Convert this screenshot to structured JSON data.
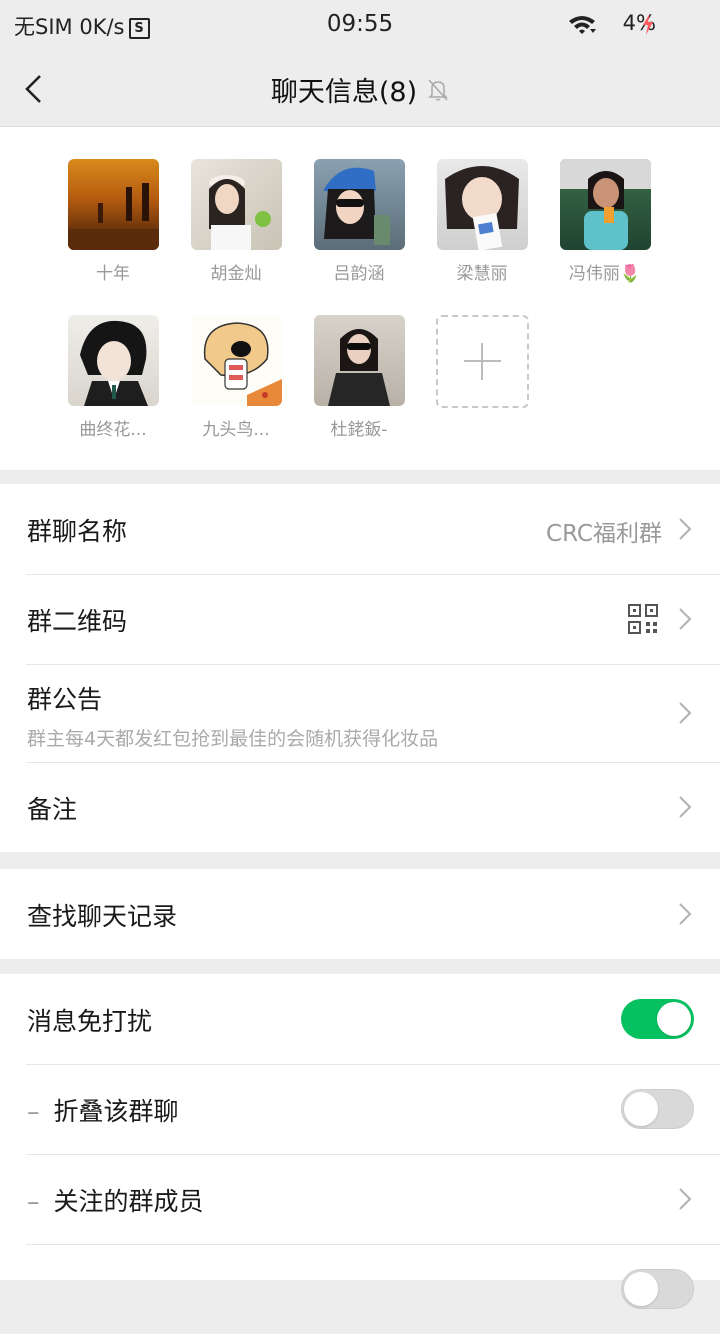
{
  "status_bar": {
    "carrier": "无SIM",
    "speed": "0K/s",
    "s_badge": "S",
    "time": "09:55",
    "battery": "4%"
  },
  "nav": {
    "title": "聊天信息(8)",
    "back_icon": "chevron-left-icon",
    "mute_icon": "bell-off-icon"
  },
  "members": [
    {
      "name": "十年"
    },
    {
      "name": "胡金灿"
    },
    {
      "name": "吕韵涵"
    },
    {
      "name": "梁慧丽"
    },
    {
      "name": "冯伟丽🌷"
    },
    {
      "name": "曲终花..."
    },
    {
      "name": "九头鸟..."
    },
    {
      "name": "杜銠鈑-"
    }
  ],
  "rows": {
    "group_name": {
      "label": "群聊名称",
      "value": "CRC福利群"
    },
    "qrcode": {
      "label": "群二维码"
    },
    "notice": {
      "label": "群公告",
      "sub": "群主每4天都发红包抢到最佳的会随机获得化妆品"
    },
    "remark": {
      "label": "备注"
    },
    "search": {
      "label": "查找聊天记录"
    },
    "mute": {
      "label": "消息免打扰",
      "on": true
    },
    "fold": {
      "label": "折叠该群聊",
      "on": false
    },
    "follow": {
      "label": "关注的群成员"
    }
  },
  "colors": {
    "accent_green": "#07c160",
    "background": "#ededed"
  }
}
